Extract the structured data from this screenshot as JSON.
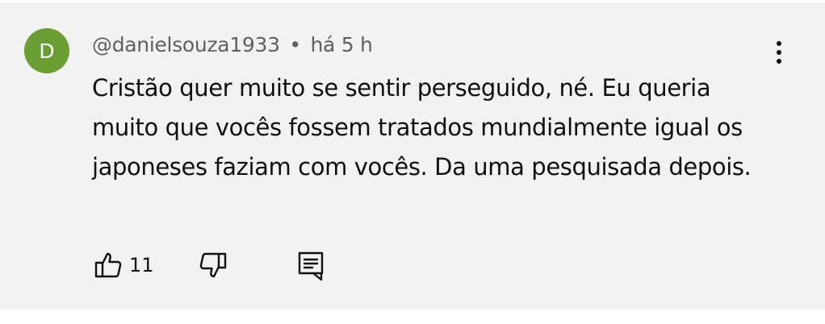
{
  "comment": {
    "avatar_letter": "D",
    "author": "@danielsouza1933",
    "separator": "•",
    "time": "há 5 h",
    "text": "Cristão quer muito se sentir perseguido, né. Eu queria muito que vocês fossem tratados mundialmente igual os japoneses faziam com vocês. Da uma pesquisada depois.",
    "like_count": "11"
  },
  "colors": {
    "card_bg": "#f2f2f2",
    "avatar_bg": "#6a9e35",
    "meta_text": "#606060",
    "body_text": "#0f0f0f"
  },
  "icons": {
    "menu": "more-vertical-icon",
    "like": "thumbs-up-icon",
    "dislike": "thumbs-down-icon",
    "reply": "reply-comment-icon"
  }
}
